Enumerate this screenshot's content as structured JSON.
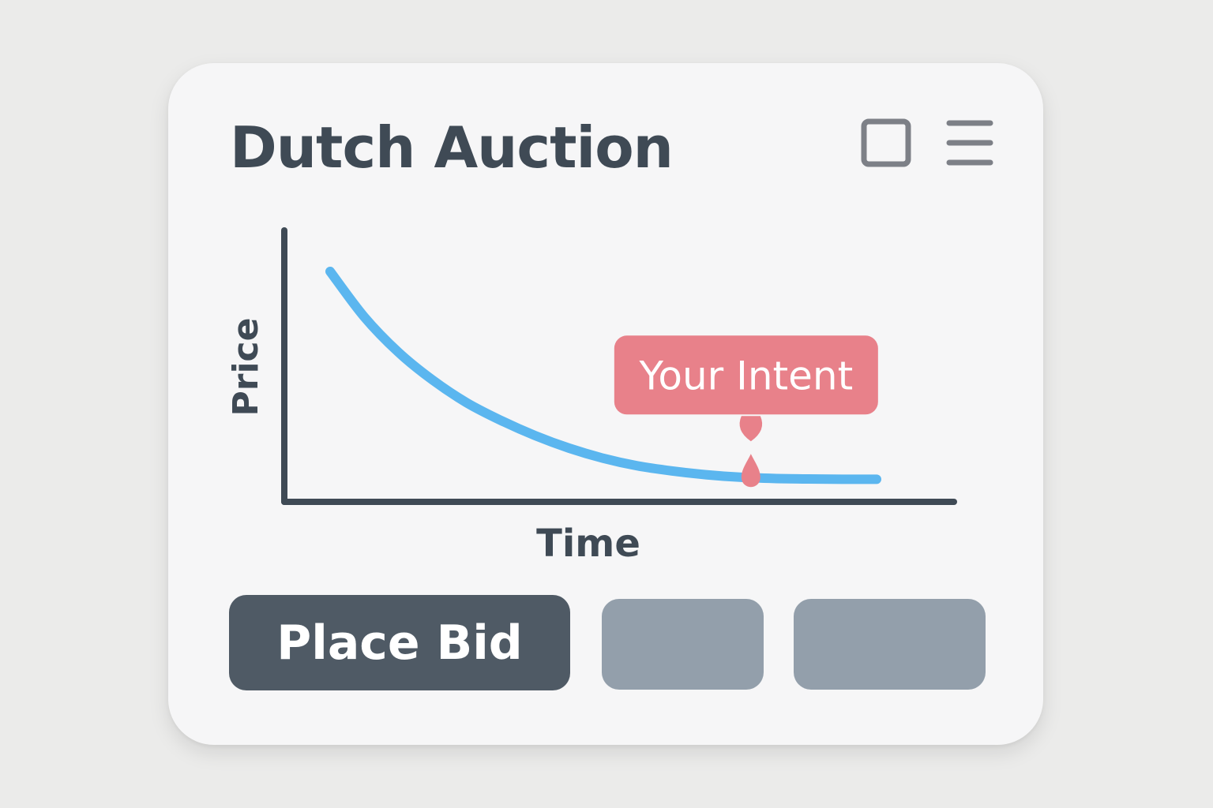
{
  "panel": {
    "title": "Dutch Auction",
    "header_icons": [
      "square-icon",
      "hamburger-menu-icon"
    ]
  },
  "chart_data": {
    "type": "line",
    "xlabel": "Time",
    "ylabel": "Price",
    "series": [
      {
        "values": [
          0.9,
          0.72,
          0.58,
          0.47,
          0.38,
          0.31,
          0.25,
          0.2,
          0.16,
          0.13,
          0.11,
          0.095,
          0.085,
          0.08,
          0.078,
          0.077,
          0.077
        ],
        "color": "#5bb6ef"
      }
    ],
    "annotation": {
      "label": "Your Intent",
      "x_fraction": 0.77,
      "color": "#e8818a"
    },
    "grid": false,
    "legend": "none"
  },
  "actions": {
    "primary_label": "Place Bid",
    "primary_color": "#4f5a65",
    "secondary_color": "#939fab"
  },
  "colors": {
    "background": "#ebebea",
    "card": "#f6f6f7",
    "text": "#3f4a55",
    "curve": "#5bb6ef",
    "marker": "#e8818a"
  }
}
